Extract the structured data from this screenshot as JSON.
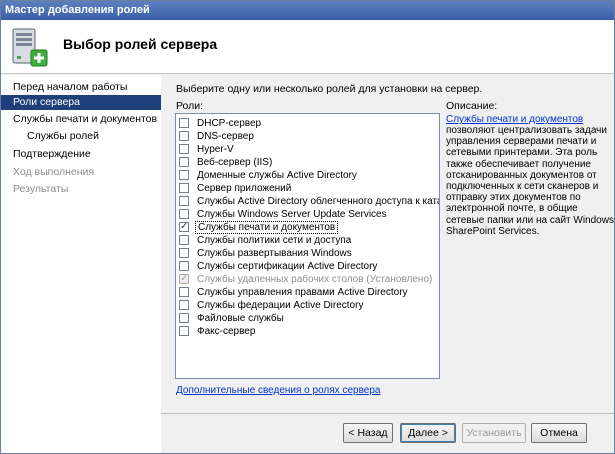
{
  "window": {
    "title": "Мастер добавления ролей"
  },
  "header": {
    "title": "Выбор ролей сервера"
  },
  "sidebar": {
    "items": [
      {
        "label": "Перед началом работы",
        "state": "normal"
      },
      {
        "label": "Роли сервера",
        "state": "active"
      },
      {
        "label": "Службы печати и документов",
        "state": "normal"
      },
      {
        "label": "Службы ролей",
        "state": "sub"
      },
      {
        "label": "Подтверждение",
        "state": "normal"
      },
      {
        "label": "Ход выполнения",
        "state": "disabled"
      },
      {
        "label": "Результаты",
        "state": "disabled"
      }
    ]
  },
  "main": {
    "instruction": "Выберите одну или несколько ролей для установки на сервер.",
    "roles_label": "Роли:",
    "description_label": "Описание:",
    "roles": [
      {
        "label": "DHCP-сервер",
        "checked": false
      },
      {
        "label": "DNS-сервер",
        "checked": false
      },
      {
        "label": "Hyper-V",
        "checked": false
      },
      {
        "label": "Веб-сервер (IIS)",
        "checked": false
      },
      {
        "label": "Доменные службы Active Directory",
        "checked": false
      },
      {
        "label": "Сервер приложений",
        "checked": false
      },
      {
        "label": "Службы Active Directory облегченного доступа к каталогам",
        "checked": false
      },
      {
        "label": "Службы Windows Server Update Services",
        "checked": false
      },
      {
        "label": "Службы печати и документов",
        "checked": true,
        "selected": true
      },
      {
        "label": "Службы политики сети и доступа",
        "checked": false
      },
      {
        "label": "Службы развертывания Windows",
        "checked": false
      },
      {
        "label": "Службы сертификации Active Directory",
        "checked": false
      },
      {
        "label": "Службы удаленных рабочих столов  (Установлено)",
        "checked": true,
        "disabled": true
      },
      {
        "label": "Службы управления правами Active Directory",
        "checked": false
      },
      {
        "label": "Службы федерации Active Directory",
        "checked": false
      },
      {
        "label": "Файловые службы",
        "checked": false
      },
      {
        "label": "Факс-сервер",
        "checked": false
      }
    ],
    "description_link": "Службы печати и документов",
    "description_text": "позволяют централизовать задачи управления серверами печати и сетевыми принтерами. Эта роль также обеспечивает получение отсканированных документов от подключенных к сети сканеров и отправку этих документов по электронной почте, в общие сетевые папки или на сайт Windows SharePoint Services.",
    "more_info_link": "Дополнительные сведения о ролях сервера"
  },
  "buttons": {
    "back": "< Назад",
    "next": "Далее >",
    "install": "Установить",
    "cancel": "Отмена"
  }
}
